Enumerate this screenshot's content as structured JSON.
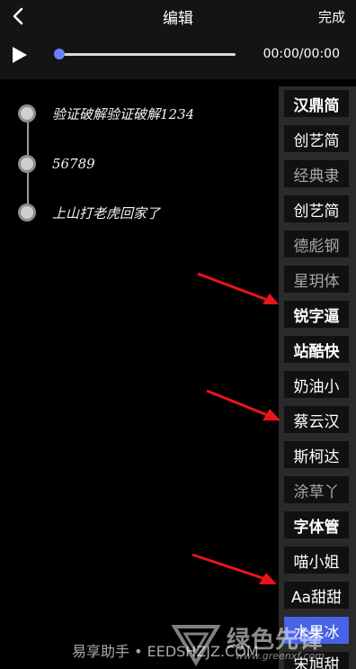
{
  "header": {
    "title": "编辑",
    "done_label": "完成"
  },
  "player": {
    "time_display": "00:00/00:00",
    "progress": 0.0
  },
  "text_items": [
    "验证破解验证破解1234",
    "56789",
    "上山打老虎回家了"
  ],
  "font_list": [
    {
      "label": "汉鼎简",
      "style": "bold"
    },
    {
      "label": "创艺简",
      "style": "normal"
    },
    {
      "label": "经典隶",
      "style": "dim"
    },
    {
      "label": "创艺简",
      "style": "normal"
    },
    {
      "label": "德彪钢",
      "style": "dim"
    },
    {
      "label": "星玥体",
      "style": "dim"
    },
    {
      "label": "锐字逼",
      "style": "bold"
    },
    {
      "label": "站酷快",
      "style": "bold"
    },
    {
      "label": "奶油小",
      "style": "normal"
    },
    {
      "label": "蔡云汉",
      "style": "normal"
    },
    {
      "label": "斯柯达",
      "style": "normal"
    },
    {
      "label": "涂草丫",
      "style": "dim"
    },
    {
      "label": "字体管",
      "style": "bold"
    },
    {
      "label": "喵小姐",
      "style": "normal"
    },
    {
      "label": "Aa甜甜",
      "style": "normal"
    },
    {
      "label": "水果冰",
      "style": "selected"
    },
    {
      "label": "宋旭甜",
      "style": "normal"
    }
  ],
  "watermark": {
    "left_text": "易享助手 • EEDSHZJZ.COM",
    "right_text": "绿色先锋",
    "url_text": "www.greenxf.com"
  },
  "colors": {
    "accent": "#4863e6",
    "arrow": "#e8141c",
    "background": "#000000"
  },
  "icons": {
    "back": "chevron-left-icon",
    "play": "play-icon"
  }
}
